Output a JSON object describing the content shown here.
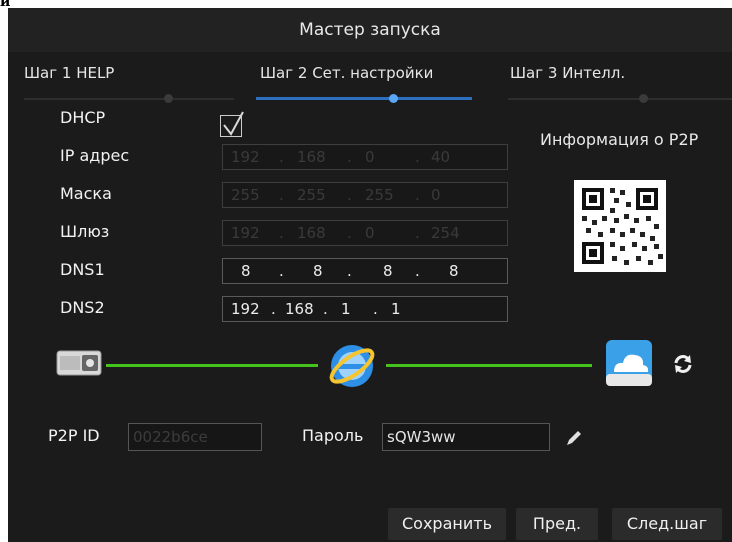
{
  "corner_text": "и",
  "window": {
    "title": "Мастер запуска"
  },
  "steps": [
    {
      "label": "Шаг 1 HELP"
    },
    {
      "label": "Шаг 2 Сет. настройки"
    },
    {
      "label": "Шаг 3 Интелл."
    }
  ],
  "form": {
    "dhcp_label": "DHCP",
    "dhcp_checked": true,
    "ip_label": "IP адрес",
    "ip": [
      "192",
      "168",
      "0",
      "40"
    ],
    "mask_label": "Маска",
    "mask": [
      "255",
      "255",
      "255",
      "0"
    ],
    "gateway_label": "Шлюз",
    "gateway": [
      "192",
      "168",
      "0",
      "254"
    ],
    "dns1_label": "DNS1",
    "dns1": [
      "8",
      "8",
      "8",
      "8"
    ],
    "dns2_label": "DNS2",
    "dns2": [
      "192",
      "168",
      "1",
      "1"
    ]
  },
  "p2p_info_title": "Информация о P2P",
  "connection": {
    "icons": [
      "dvr-device-icon",
      "internet-globe-icon",
      "cloud-icon",
      "refresh-icon"
    ],
    "line_color": "#46c21d"
  },
  "p2p": {
    "id_label": "P2P ID",
    "id_value": "0022b6ce",
    "password_label": "Пароль",
    "password_value": "sQW3ww"
  },
  "buttons": {
    "save": "Сохранить",
    "prev": "Пред.",
    "next": "След.шаг"
  },
  "colors": {
    "accent": "#2c6fbf",
    "active_dot": "#5aa8f5",
    "link_line": "#46c21d"
  }
}
